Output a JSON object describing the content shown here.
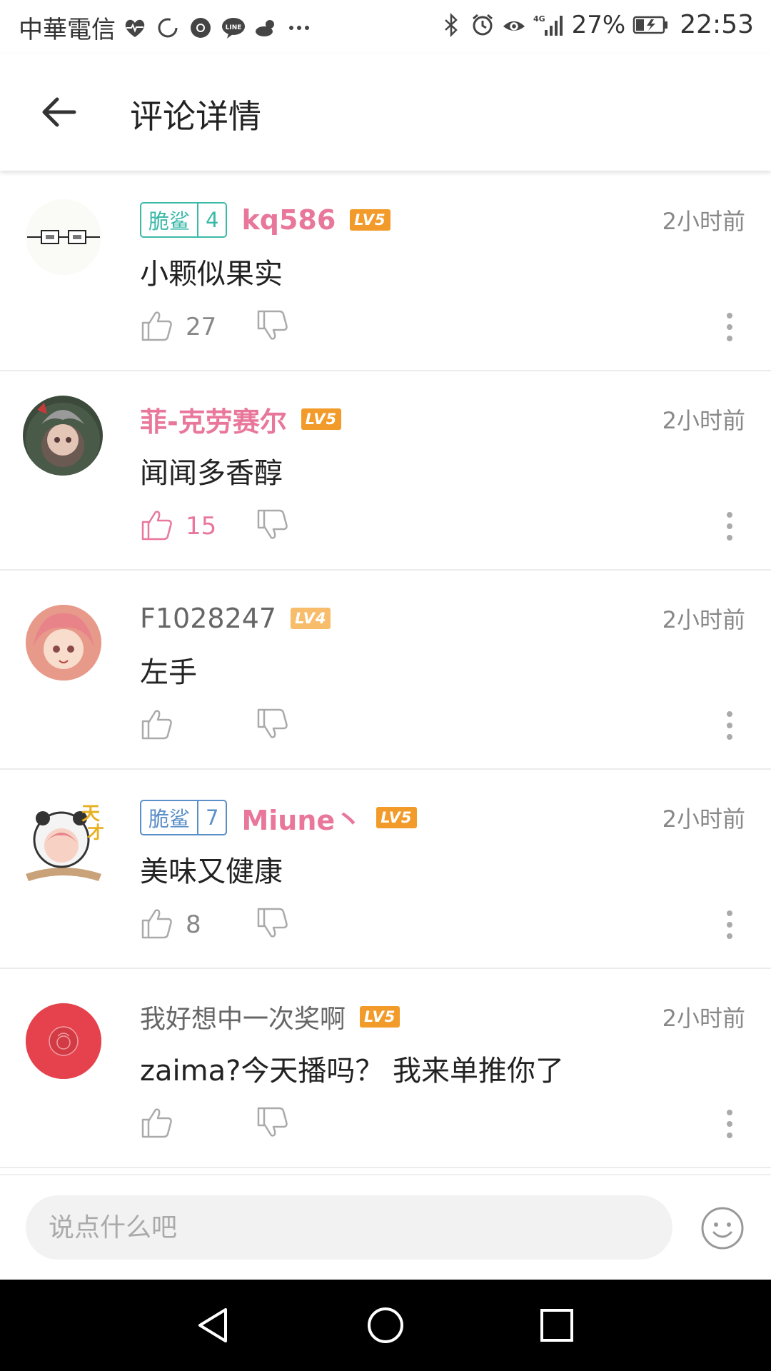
{
  "status_bar": {
    "carrier": "中華電信",
    "network": "4G",
    "battery": "27%",
    "time": "22:53",
    "icons": [
      "heart-rate-icon",
      "sync-icon",
      "chrome-icon",
      "line-icon",
      "weather-icon",
      "more-icon",
      "bluetooth-icon",
      "alarm-icon",
      "eye-icon",
      "signal-icon",
      "battery-icon"
    ]
  },
  "header": {
    "title": "评论详情"
  },
  "comments": [
    {
      "fan_badge": {
        "name": "脆鲨",
        "level": "4",
        "color": "#3bb9a8"
      },
      "username": "kq586",
      "user_level": "LV5",
      "time": "2小时前",
      "content": "小颗似果实",
      "likes": "27",
      "liked": false
    },
    {
      "username": "菲-克劳赛尔",
      "user_level": "LV5",
      "time": "2小时前",
      "content": "闻闻多香醇",
      "likes": "15",
      "liked": true
    },
    {
      "username": "F1028247",
      "user_level": "LV4",
      "time": "2小时前",
      "content": "左手",
      "likes": "",
      "liked": false
    },
    {
      "fan_badge": {
        "name": "脆鲨",
        "level": "7",
        "color": "#5b8fc7"
      },
      "username": "Miune丶",
      "user_level": "LV5",
      "time": "2小时前",
      "content": "美味又健康",
      "likes": "8",
      "liked": false
    },
    {
      "username": "我好想中一次奖啊",
      "user_level": "LV5",
      "time": "2小时前",
      "content": "zaima?今天播吗？ 我来单推你了",
      "likes": "",
      "liked": false
    }
  ],
  "input": {
    "placeholder": "说点什么吧"
  },
  "colors": {
    "accent": "#e8779b",
    "level_badge": "#f29b2a",
    "nav_bar": "#000000"
  }
}
